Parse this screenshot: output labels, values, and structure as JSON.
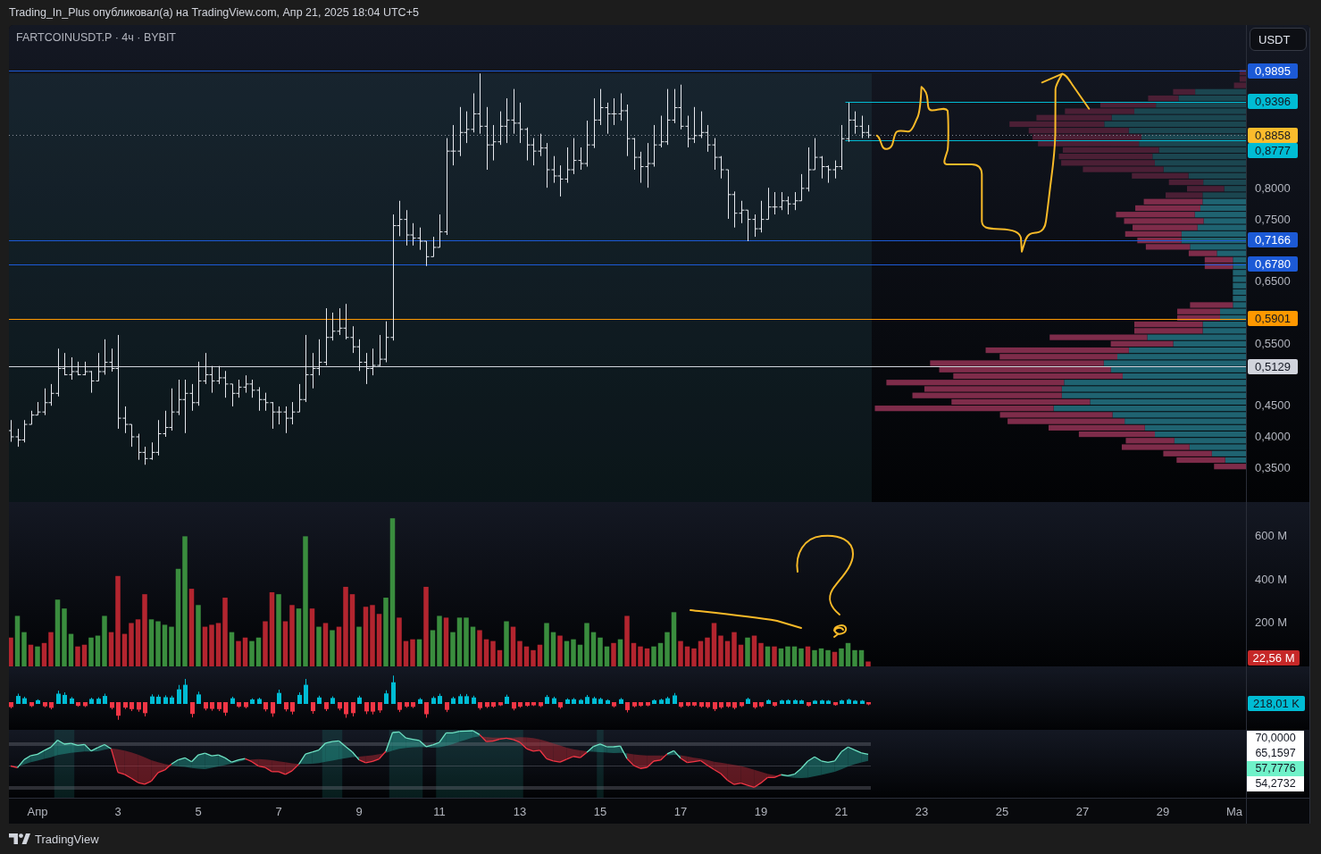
{
  "header": {
    "text": "Trading_In_Plus опубликовал(а) на TradingView.com, Апр 21, 2025 18:04 UTC+5"
  },
  "chart": {
    "symbol": "FARTCOINUSDT.P · 4ч · BYBIT",
    "currency_button": "USDT",
    "price_pane": {
      "axis_labels": [
        "0,8000",
        "0,7500",
        "0,6500",
        "0,5500",
        "0,4500",
        "0,4000",
        "0,3500"
      ],
      "levels": [
        {
          "kind": "line",
          "label": "0,9895",
          "color": "#1c5ad6"
        },
        {
          "kind": "ray",
          "label": "0,9396",
          "color": "#00bcd4"
        },
        {
          "kind": "price",
          "label": "0,8858",
          "color": "#fbbc2c"
        },
        {
          "kind": "ray",
          "label": "0,8777",
          "color": "#00bcd4"
        },
        {
          "kind": "line",
          "label": "0,7166",
          "color": "#1c5ad6"
        },
        {
          "kind": "line",
          "label": "0,6780",
          "color": "#1c5ad6"
        },
        {
          "kind": "line",
          "label": "0,5901",
          "color": "#ff9800"
        },
        {
          "kind": "line",
          "label": "0,5129",
          "color": "#d1d4dc"
        }
      ]
    },
    "volume_pane": {
      "axis_labels": [
        "600 M",
        "400 M",
        "200 M"
      ],
      "last_tag": {
        "label": "22,56 M",
        "color": "#c62828"
      }
    },
    "delta_pane": {
      "tag": {
        "label": "218,01 K",
        "color": "#00bcd4"
      }
    },
    "oscillator_pane": {
      "labels": [
        {
          "label": "70,0000",
          "color": "#ffffff"
        },
        {
          "label": "65,1597",
          "color": "#ffffff"
        },
        {
          "label": "57,7776",
          "color": "#6ff2c9"
        },
        {
          "label": "54,2732",
          "color": "#ffffff"
        }
      ]
    },
    "time_axis": {
      "labels": [
        "Апр",
        "3",
        "5",
        "7",
        "9",
        "11",
        "13",
        "15",
        "17",
        "19",
        "21",
        "23",
        "25",
        "27",
        "29",
        "Ма"
      ]
    }
  },
  "footer": {
    "brand": "TradingView"
  }
}
